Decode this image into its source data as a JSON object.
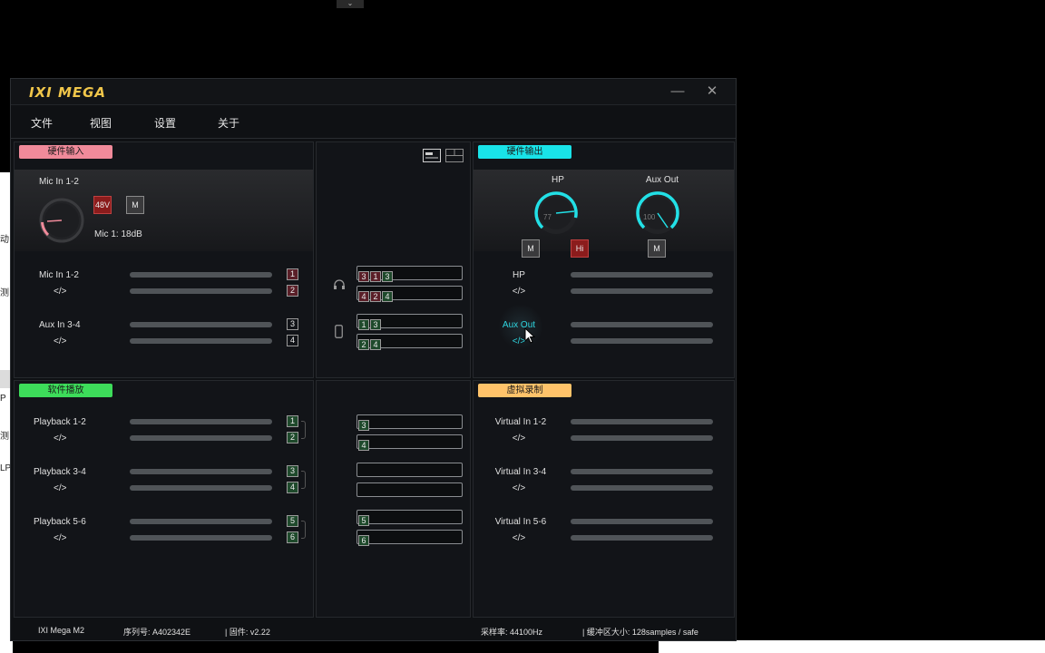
{
  "app": {
    "logo": "IXI MEGA",
    "minimize": "—",
    "close": "✕"
  },
  "menu": [
    "文件",
    "视图",
    "设置",
    "关于"
  ],
  "panels": {
    "hw_in": {
      "tag": "硬件输入",
      "tag_color": "#f08a9a"
    },
    "hw_out": {
      "tag": "硬件输出",
      "tag_color": "#19e3e8"
    },
    "sw_play": {
      "tag": "软件播放",
      "tag_color": "#3ddc5a"
    },
    "virt_rec": {
      "tag": "虚拟录制",
      "tag_color": "#ffc36a"
    }
  },
  "hw_in": {
    "mic_title": "Mic In 1-2",
    "btn_48v": "48V",
    "btn_m": "M",
    "mic_gain": "Mic 1: 18dB",
    "rows": [
      {
        "name": "Mic In 1-2",
        "link": "</>",
        "ch": [
          "1",
          "2"
        ]
      },
      {
        "name": "Aux In 3-4",
        "link": "</>",
        "ch": [
          "3",
          "4"
        ]
      }
    ]
  },
  "hw_out": {
    "hp_title": "HP",
    "hp_value": "77",
    "aux_title": "Aux Out",
    "aux_value": "100",
    "btn_hp_m": "M",
    "btn_hi": "Hi",
    "btn_aux_m": "M",
    "rows": [
      {
        "name": "HP",
        "link": "</>"
      },
      {
        "name": "Aux Out",
        "link": "</>"
      }
    ]
  },
  "routing_top": [
    [
      "3",
      "1",
      "3"
    ],
    [
      "4",
      "2",
      "4"
    ],
    [
      "1",
      "3"
    ],
    [
      "2",
      "4"
    ]
  ],
  "routing_bottom": [
    [
      "3"
    ],
    [
      "4"
    ],
    [],
    [],
    [
      "5"
    ],
    [
      "6"
    ]
  ],
  "sw_play": {
    "rows": [
      {
        "name": "Playback 1-2",
        "link": "</>",
        "ch": [
          "1",
          "2"
        ]
      },
      {
        "name": "Playback 3-4",
        "link": "</>",
        "ch": [
          "3",
          "4"
        ]
      },
      {
        "name": "Playback 5-6",
        "link": "</>",
        "ch": [
          "5",
          "6"
        ]
      }
    ]
  },
  "virt_rec": {
    "rows": [
      {
        "name": "Virtual In 1-2",
        "link": "</>"
      },
      {
        "name": "Virtual In 3-4",
        "link": "</>"
      },
      {
        "name": "Virtual In 5-6",
        "link": "</>"
      }
    ]
  },
  "status": {
    "device": "IXI Mega M2",
    "serial": "序列号: A402342E",
    "firmware": "| 固件: v2.22",
    "sample_rate": "采样率: 44100Hz",
    "buffer": "| 缓冲区大小: 128samples / safe"
  },
  "colors": {
    "knob_in": "#f08a9a",
    "knob_out": "#22e0e6",
    "accent_cyan": "#2fd6e0"
  },
  "bg": {
    "frag1": "动",
    "frag2": "测",
    "frag3": "P",
    "frag4": "测",
    "frag5": "LP"
  }
}
